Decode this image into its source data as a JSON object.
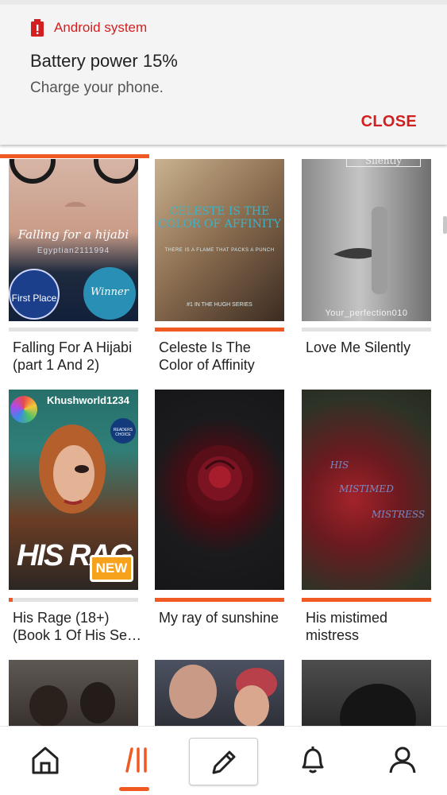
{
  "notification": {
    "app_name": "Android system",
    "title": "Battery power 15%",
    "body": "Charge your phone.",
    "action": "CLOSE",
    "accent_color": "#d21f1f",
    "icon": "battery-alert-icon"
  },
  "library": {
    "accent_color": "#f05a22",
    "stories": [
      {
        "title": "Falling For A Hijabi\n(part 1 And 2)",
        "progress": 0,
        "cover": {
          "title_text": "Falling for a hijabi",
          "author_text": "Egyptian2111994",
          "badge_1": "First Place",
          "badge_2": "Winner"
        }
      },
      {
        "title": "Celeste Is The\nColor of Affinity",
        "progress": 1.0,
        "cover": {
          "title_text": "CELESTE IS THE COLOR OF AFFINITY",
          "subtitle_text": "THERE IS A FLAME THAT PACKS A PUNCH",
          "series_text": "#1 IN THE HUGH SERIES"
        }
      },
      {
        "title": "Love Me Silently",
        "progress": 0,
        "cover": {
          "title_text": "Silently",
          "author_text": "Your_perfection010"
        }
      },
      {
        "title": "His Rage (18+)\n(Book 1 Of His Se…",
        "progress": 0.03,
        "is_new": true,
        "new_label": "NEW",
        "cover": {
          "author_text": "Khushworld1234",
          "title_text": "HIS RAG",
          "badge_text": "READERS CHOICE"
        }
      },
      {
        "title": "My ray of sunshine",
        "progress": 1.0,
        "cover": {}
      },
      {
        "title": "His mistimed\nmistress",
        "progress": 1.0,
        "cover": {
          "line_1": "HIS",
          "line_2": "MISTIMED",
          "line_3": "MISTRESS"
        }
      }
    ]
  },
  "bottom_nav": {
    "items": [
      {
        "name": "home",
        "icon": "home-icon"
      },
      {
        "name": "library",
        "icon": "library-icon",
        "active": true
      },
      {
        "name": "write",
        "icon": "pencil-icon"
      },
      {
        "name": "notifications",
        "icon": "bell-icon"
      },
      {
        "name": "profile",
        "icon": "profile-icon"
      }
    ]
  }
}
